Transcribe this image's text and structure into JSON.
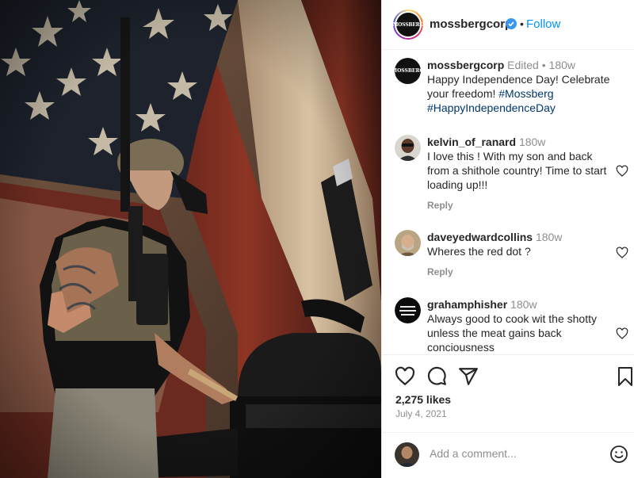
{
  "post": {
    "author": "mossbergcorp",
    "follow_label": "Follow",
    "dot": "•",
    "brand_mark": "MOSSBERG",
    "caption": {
      "username": "mossbergcorp",
      "edited": "Edited",
      "dot": "•",
      "age": "180w",
      "text": "Happy Independence Day! Celebrate your freedom!",
      "hashtags": [
        "#Mossberg",
        "#HappyIndependenceDay"
      ]
    },
    "comments": [
      {
        "username": "kelvin_of_ranard",
        "age": "180w",
        "text": "I love this ! With my son and back from a shithole country! Time to start loading up!!!",
        "reply": "Reply"
      },
      {
        "username": "daveyedwardcollins",
        "age": "180w",
        "text": "Wheres the red dot ?",
        "reply": "Reply"
      },
      {
        "username": "grahamphisher",
        "age": "180w",
        "text": "Always good to cook wit the shotty unless the meat gains back conciousness"
      }
    ],
    "likes": "2,275 likes",
    "date": "July 4, 2021",
    "add_comment_placeholder": "Add a comment..."
  },
  "icons": [
    "verified-icon",
    "heart-icon",
    "comment-icon",
    "share-icon",
    "bookmark-icon",
    "emoji-icon",
    "small-heart-icon"
  ],
  "colors": {
    "link": "#0095f6",
    "hashtag": "#00376b",
    "muted": "#8e8e8e",
    "verified": "#3897f0"
  }
}
